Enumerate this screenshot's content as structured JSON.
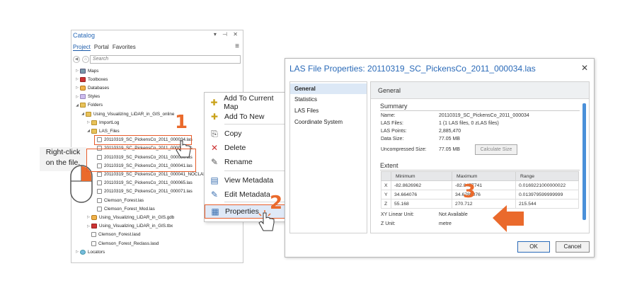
{
  "catalog": {
    "title": "Catalog",
    "pins": "▾ ⊣ ✕",
    "tabs": [
      "Project",
      "Portal",
      "Favorites"
    ],
    "menu_icon": "hamburger-icon",
    "search_placeholder": "Search",
    "tree": [
      {
        "label": "Maps",
        "icon": "map"
      },
      {
        "label": "Toolboxes",
        "icon": "tool"
      },
      {
        "label": "Databases",
        "icon": "db"
      },
      {
        "label": "Styles",
        "icon": "style"
      },
      {
        "label": "Folders",
        "icon": "folder"
      },
      {
        "label": "Using_Visualizing_LiDAR_in_GIS_online",
        "icon": "folder"
      },
      {
        "label": "ImportLog",
        "icon": "folder"
      },
      {
        "label": "LAS_Files",
        "icon": "folder"
      },
      {
        "label": "20110319_SC_PickensCo_2011_000034.las",
        "icon": "file"
      },
      {
        "label": "20110319_SC_PickensCo_2011_000035.las",
        "icon": "file"
      },
      {
        "label": "20110319_SC_PickensCo_2011_000036.las",
        "icon": "file"
      },
      {
        "label": "20110319_SC_PickensCo_2011_000041.las",
        "icon": "file"
      },
      {
        "label": "20110319_SC_PickensCo_2011_000041_NOCLASS.las",
        "icon": "file"
      },
      {
        "label": "20110319_SC_PickensCo_2011_000065.las",
        "icon": "file"
      },
      {
        "label": "20110319_SC_PickensCo_2011_000071.las",
        "icon": "file"
      },
      {
        "label": "Clemson_Forest.las",
        "icon": "file"
      },
      {
        "label": "Clemson_Forest_Mod.las",
        "icon": "file"
      },
      {
        "label": "Using_Visualizing_LiDAR_in_GIS.gdb",
        "icon": "db"
      },
      {
        "label": "Using_Visualizing_LiDAR_in_GIS.tbx",
        "icon": "tool"
      },
      {
        "label": "Clemson_Forest.lasd",
        "icon": "file"
      },
      {
        "label": "Clemson_Forest_Reclass.lasd",
        "icon": "file"
      },
      {
        "label": "Locators",
        "icon": "loc"
      }
    ]
  },
  "context_menu": {
    "items": [
      {
        "label": "Add To Current Map",
        "icon": "add-map-icon"
      },
      {
        "label": "Add To New",
        "icon": "add-new-icon"
      },
      {
        "label": "Copy",
        "icon": "copy-icon"
      },
      {
        "label": "Delete",
        "icon": "delete-icon"
      },
      {
        "label": "Rename",
        "icon": "rename-icon"
      },
      {
        "label": "View Metadata",
        "icon": "view-metadata-icon"
      },
      {
        "label": "Edit Metadata",
        "icon": "edit-metadata-icon"
      },
      {
        "label": "Properties",
        "icon": "properties-icon"
      }
    ]
  },
  "callout": {
    "line1": "Right-click",
    "line2": "on the file."
  },
  "steps": {
    "one": "1",
    "two": "2",
    "three": "3"
  },
  "dialog": {
    "title": "LAS File Properties: 20110319_SC_PickensCo_2011_000034.las",
    "close": "✕",
    "nav": [
      "General",
      "Statistics",
      "LAS Files",
      "Coordinate System"
    ],
    "section": "General",
    "summary": {
      "heading": "Summary",
      "rows": [
        {
          "key": "Name:",
          "value": "20110319_SC_PickensCo_2011_000034"
        },
        {
          "key": "LAS Files:",
          "value": "1 (1 LAS files, 0 zLAS files)"
        },
        {
          "key": "LAS Points:",
          "value": "2,885,470"
        },
        {
          "key": "Data Size:",
          "value": "77.05 MB"
        },
        {
          "key": "Uncompressed Size:",
          "value": "77.05 MB"
        }
      ],
      "calc_button": "Calculate Size"
    },
    "extent": {
      "heading": "Extent",
      "columns": [
        "",
        "Minimum",
        "Maximum",
        "Range"
      ],
      "rows": [
        [
          "X",
          "-82.8626962",
          "-82.8457741",
          "0.0169221000000022"
        ],
        [
          "Y",
          "34.664076",
          "34.6780076",
          "0.013979599999999"
        ],
        [
          "Z",
          "55.168",
          "270.712",
          "215.544"
        ]
      ]
    },
    "units": [
      {
        "key": "XY Linear Unit:",
        "value": "Not Available"
      },
      {
        "key": "Z Unit:",
        "value": "metre"
      }
    ],
    "ok": "OK",
    "cancel": "Cancel"
  },
  "colors": {
    "accent": "#ea6a2c",
    "title_blue": "#2a6ab8"
  }
}
